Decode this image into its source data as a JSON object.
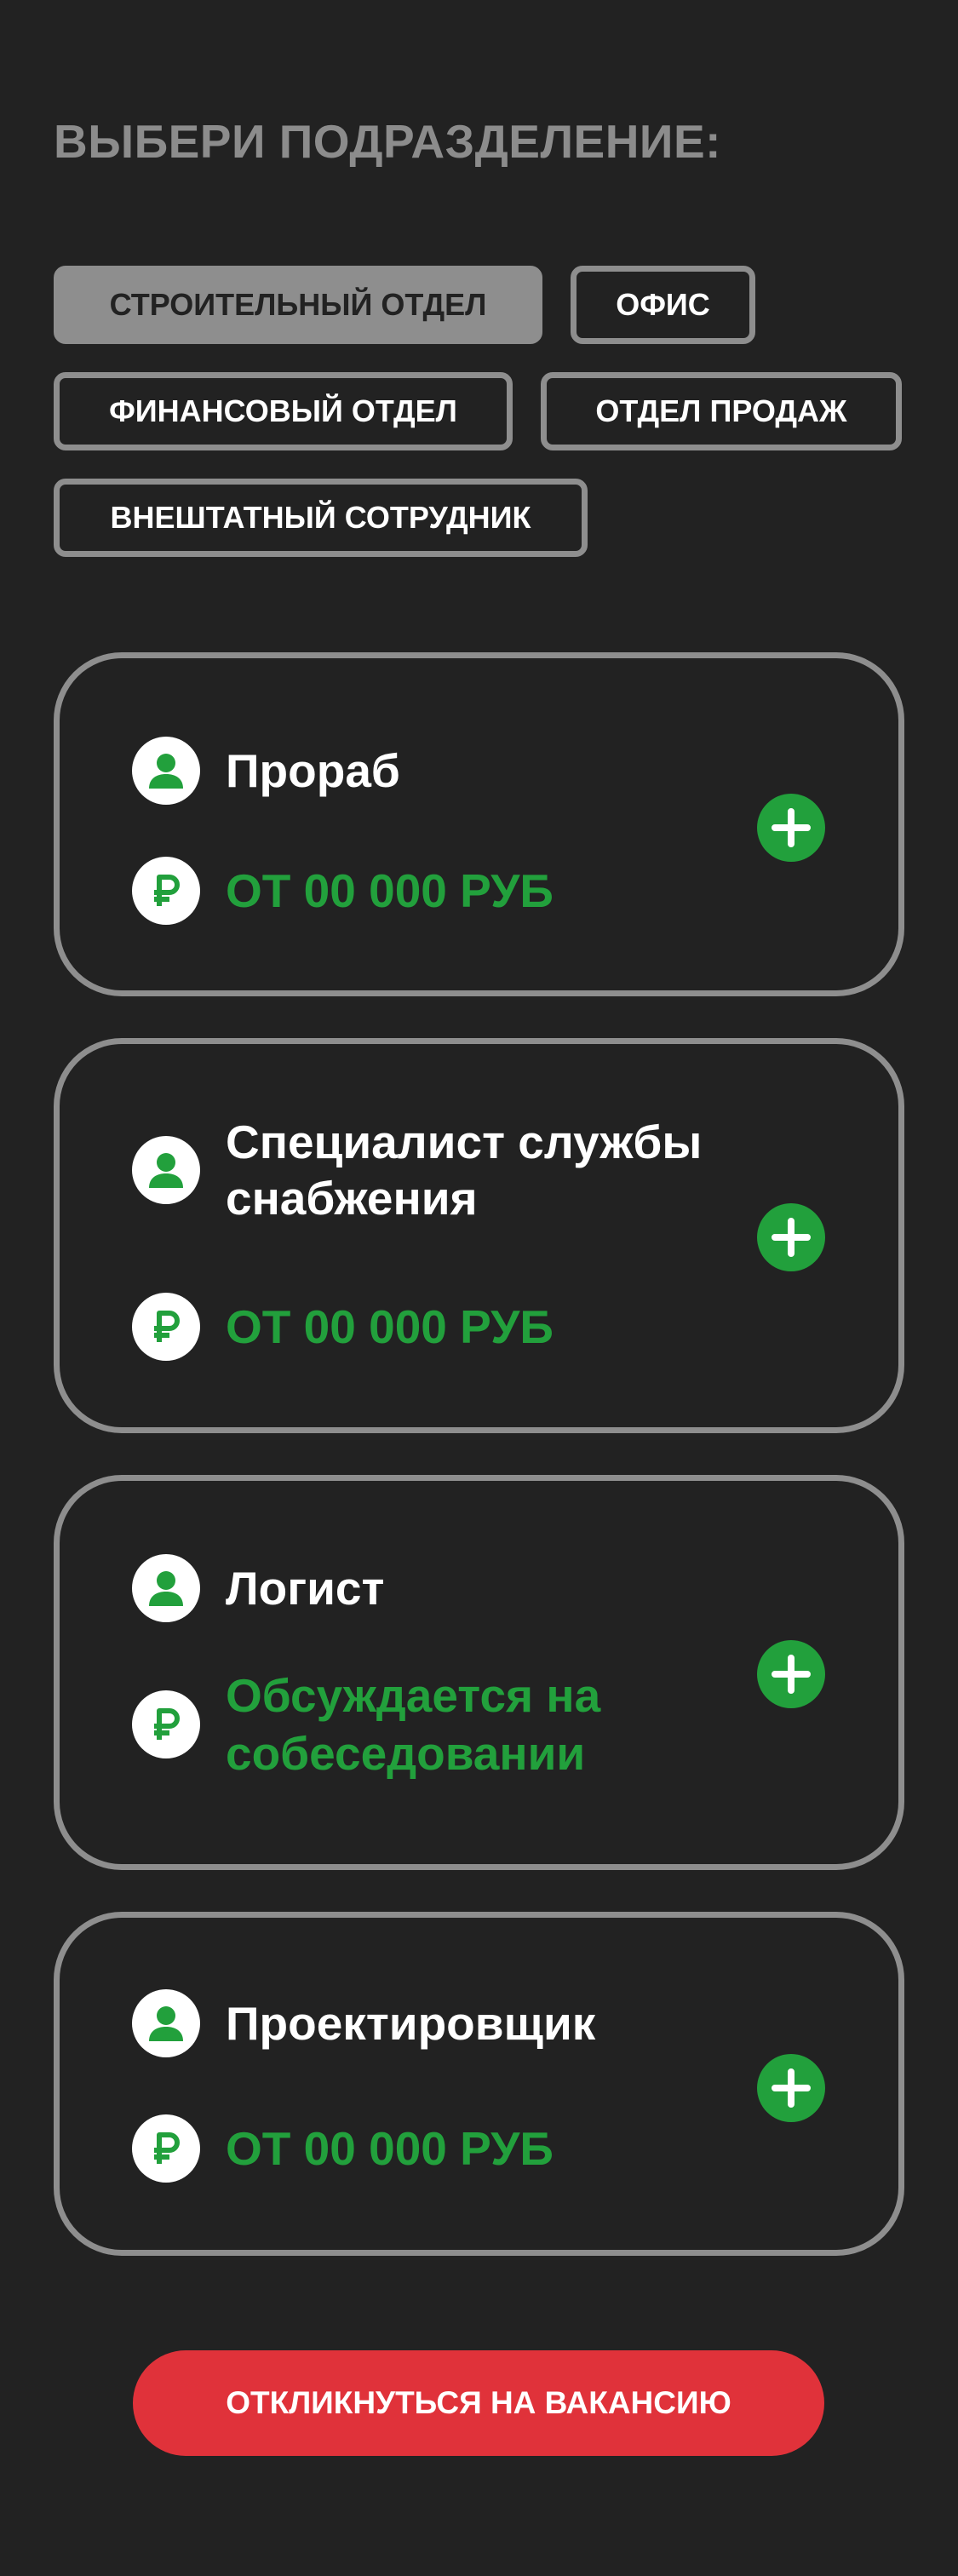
{
  "heading": "ВЫБЕРИ ПОДРАЗДЕЛЕНИЕ:",
  "departments": [
    {
      "label": "СТРОИТЕЛЬНЫЙ  ОТДЕЛ",
      "selected": true
    },
    {
      "label": "ОФИС",
      "selected": false
    },
    {
      "label": "ФИНАНСОВЫЙ  ОТДЕЛ",
      "selected": false
    },
    {
      "label": "ОТДЕЛ ПРОДАЖ",
      "selected": false
    },
    {
      "label": "ВНЕШТАТНЫЙ СОТРУДНИК",
      "selected": false
    }
  ],
  "vacancies": [
    {
      "title": "Прораб",
      "salary": "ОТ 00 000 РУБ"
    },
    {
      "title": "Специалист службы снабжения",
      "salary": "ОТ 00 000 РУБ"
    },
    {
      "title": "Логист",
      "salary": "Обсуждается на собеседовании"
    },
    {
      "title": "Проектировщик",
      "salary": "ОТ 00 000 РУБ"
    }
  ],
  "icons": {
    "person": "person-icon",
    "ruble": "ruble-icon",
    "add": "plus-icon"
  },
  "apply_button": "ОТКЛИКНУТЬСЯ НА ВАКАНСИЮ",
  "colors": {
    "background": "#222222",
    "border": "#8e8e8e",
    "accent_green": "#22a03c",
    "accent_red": "#e0323a",
    "heading": "#8c8c8c"
  }
}
